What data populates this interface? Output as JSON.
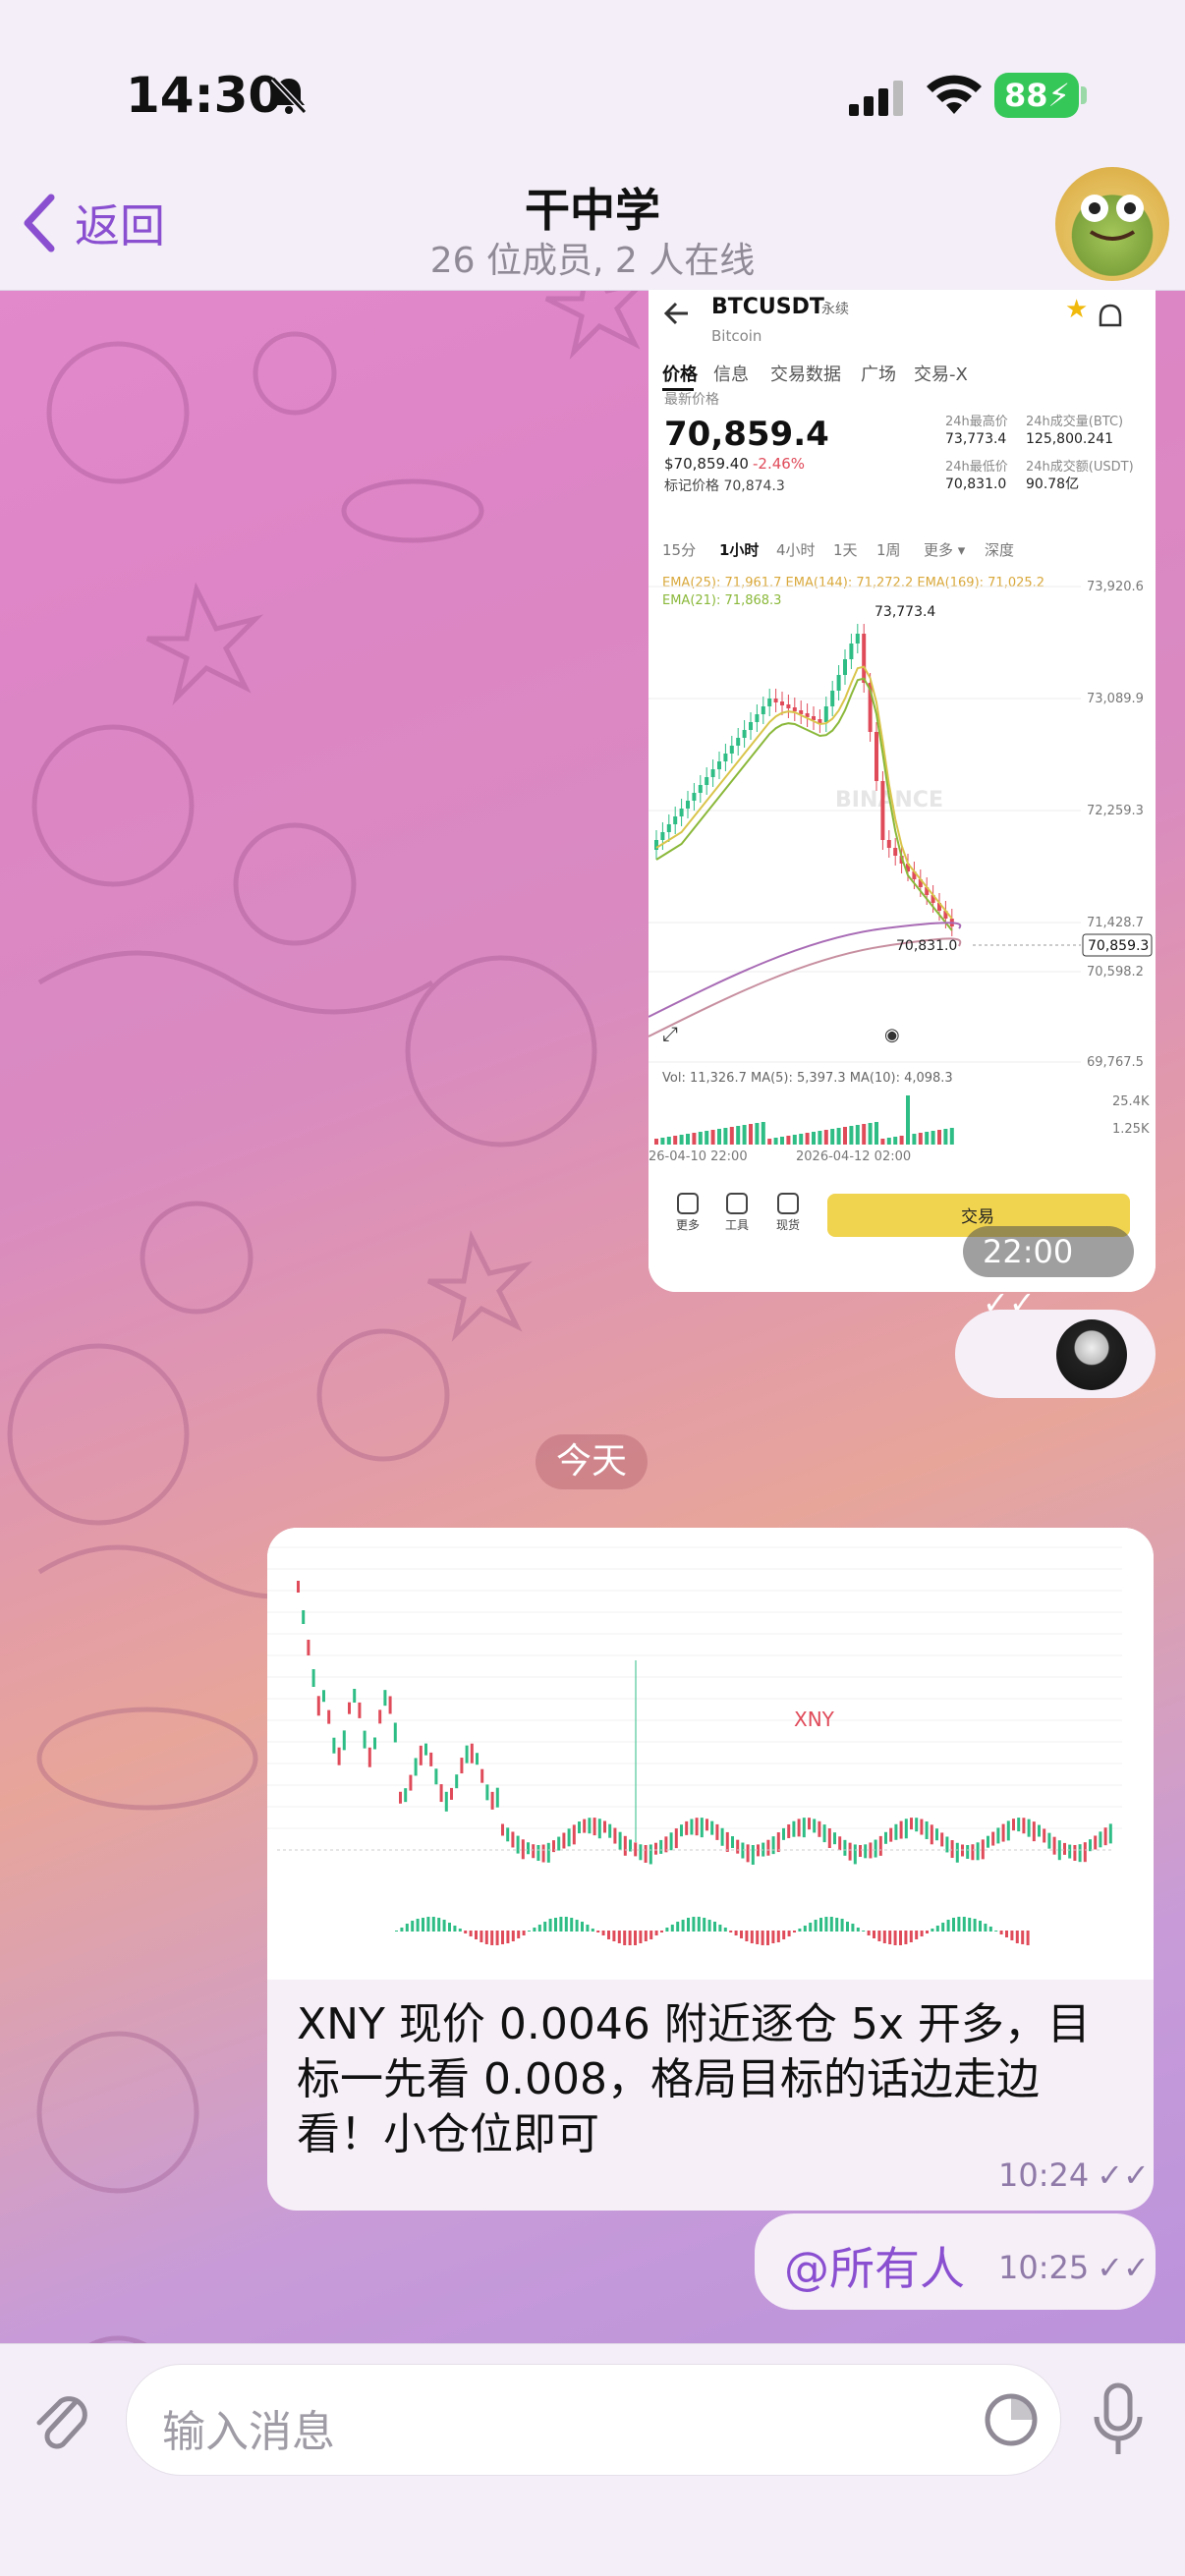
{
  "status_bar": {
    "time": "14:30",
    "battery": "88"
  },
  "header": {
    "back_label": "返回",
    "title": "干中学",
    "subtitle": "26 位成员, 2 人在线"
  },
  "btc_message": {
    "symbol": "BTCUSDT",
    "contract_type": "永续",
    "name": "Bitcoin",
    "tabs": [
      "价格",
      "信息",
      "交易数据",
      "广场",
      "交易-X"
    ],
    "last_price_label": "最新价格",
    "last_price": "70,859.4",
    "usd_price": "$70,859.40",
    "change_pct": "-2.46%",
    "mark_price": "标记价格 70,874.3",
    "high_label": "24h最高价",
    "high": "73,773.4",
    "low_label": "24h最低价",
    "low": "70,831.0",
    "vol_btc_label": "24h成交量(BTC)",
    "vol_btc": "125,800.241",
    "vol_usdt_label": "24h成交额(USDT)",
    "vol_usdt": "90.78亿",
    "intervals": [
      "15分",
      "1小时",
      "4小时",
      "1天",
      "1周",
      "更多 ▾",
      "深度"
    ],
    "ema_line1": "EMA(25): 71,961.7  EMA(144): 71,272.2  EMA(169): 71,025.2",
    "ema_line2": "EMA(21): 71,868.3",
    "price_ticks": [
      "73,920.6",
      "73,089.9",
      "72,259.3",
      "71,428.7",
      "70,598.2",
      "69,767.5"
    ],
    "peak_label": "73,773.4",
    "low_label_chart": "70,831.0",
    "current_price_tag": "70,859.3",
    "watermark": "BINANCE",
    "vol_line": "Vol: 11,326.7  MA(5): 5,397.3  MA(10): 4,098.3",
    "vol_ticks": [
      "25.4K",
      "1.25K"
    ],
    "date_left": "26-04-10 22:00",
    "date_mid": "2026-04-12 02:00",
    "bottom_icons": [
      "更多",
      "工具",
      "现货"
    ],
    "trade_button": "交易",
    "time": "22:00"
  },
  "date_separator": "今天",
  "xny_message": {
    "chart_label": "XNY",
    "text": "XNY    现价 0.0046 附近逐仓 5x 开多，目标一先看 0.008，格局目标的话边走边看！小仓位即可",
    "time": "10:24"
  },
  "mention_message": {
    "text": "@所有人",
    "time": "10:25"
  },
  "input_bar": {
    "placeholder": "输入消息"
  },
  "colors": {
    "accent": "#8a4fd0",
    "up": "#2ebd85",
    "down": "#e04b5a",
    "binance_yellow": "#f0d34f"
  }
}
